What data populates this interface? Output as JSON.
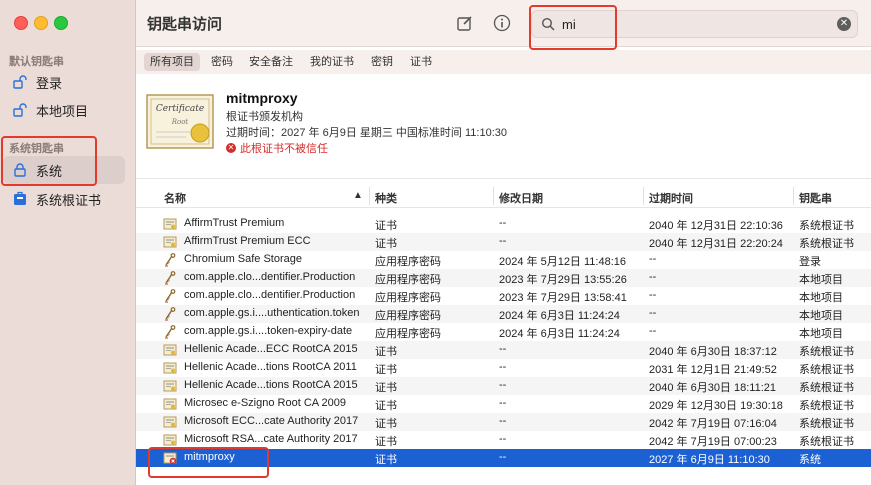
{
  "window": {
    "title": "钥匙串访问"
  },
  "sidebar": {
    "default_section": "默认钥匙串",
    "default_items": [
      {
        "label": "登录",
        "icon": "lock-open-icon"
      },
      {
        "label": "本地项目",
        "icon": "lock-open-icon"
      }
    ],
    "system_section": "系统钥匙串",
    "system_items": [
      {
        "label": "系统",
        "icon": "lock-icon",
        "selected": true
      },
      {
        "label": "系统根证书",
        "icon": "cabinet-icon"
      }
    ]
  },
  "search": {
    "value": "mi"
  },
  "tabs": [
    "所有项目",
    "密码",
    "安全备注",
    "我的证书",
    "密钥",
    "证书"
  ],
  "detail": {
    "name": "mitmproxy",
    "kind": "根证书颁发机构",
    "expire": "过期时间：2027 年 6月9日 星期三 中国标准时间 11:10:30",
    "trust": "此根证书不被信任"
  },
  "table": {
    "columns": [
      "名称",
      "种类",
      "修改日期",
      "过期时间",
      "钥匙串"
    ],
    "rows": [
      {
        "icon": "cert",
        "name": "AffirmTrust Premium",
        "kind": "证书",
        "modified": "--",
        "expires": "2040 年 12月31日 22:10:36",
        "keychain": "系统根证书"
      },
      {
        "icon": "cert",
        "name": "AffirmTrust Premium ECC",
        "kind": "证书",
        "modified": "--",
        "expires": "2040 年 12月31日 22:20:24",
        "keychain": "系统根证书"
      },
      {
        "icon": "key",
        "name": "Chromium Safe Storage",
        "kind": "应用程序密码",
        "modified": "2024 年 5月12日 11:48:16",
        "expires": "--",
        "keychain": "登录"
      },
      {
        "icon": "key",
        "name": "com.apple.clo...dentifier.Production",
        "kind": "应用程序密码",
        "modified": "2023 年 7月29日 13:55:26",
        "expires": "--",
        "keychain": "本地项目"
      },
      {
        "icon": "key",
        "name": "com.apple.clo...dentifier.Production",
        "kind": "应用程序密码",
        "modified": "2023 年 7月29日 13:58:41",
        "expires": "--",
        "keychain": "本地项目"
      },
      {
        "icon": "key",
        "name": "com.apple.gs.i....uthentication.token",
        "kind": "应用程序密码",
        "modified": "2024 年 6月3日 11:24:24",
        "expires": "--",
        "keychain": "本地项目"
      },
      {
        "icon": "key",
        "name": "com.apple.gs.i....token-expiry-date",
        "kind": "应用程序密码",
        "modified": "2024 年 6月3日 11:24:24",
        "expires": "--",
        "keychain": "本地项目"
      },
      {
        "icon": "cert",
        "name": "Hellenic Acade...ECC RootCA 2015",
        "kind": "证书",
        "modified": "--",
        "expires": "2040 年 6月30日 18:37:12",
        "keychain": "系统根证书"
      },
      {
        "icon": "cert",
        "name": "Hellenic Acade...tions RootCA 2011",
        "kind": "证书",
        "modified": "--",
        "expires": "2031 年 12月1日 21:49:52",
        "keychain": "系统根证书"
      },
      {
        "icon": "cert",
        "name": "Hellenic Acade...tions RootCA 2015",
        "kind": "证书",
        "modified": "--",
        "expires": "2040 年 6月30日 18:11:21",
        "keychain": "系统根证书"
      },
      {
        "icon": "cert",
        "name": "Microsec e-Szigno Root CA 2009",
        "kind": "证书",
        "modified": "--",
        "expires": "2029 年 12月30日 19:30:18",
        "keychain": "系统根证书"
      },
      {
        "icon": "cert",
        "name": "Microsoft ECC...cate Authority 2017",
        "kind": "证书",
        "modified": "--",
        "expires": "2042 年 7月19日 07:16:04",
        "keychain": "系统根证书"
      },
      {
        "icon": "cert",
        "name": "Microsoft RSA...cate Authority 2017",
        "kind": "证书",
        "modified": "--",
        "expires": "2042 年 7月19日 07:00:23",
        "keychain": "系统根证书"
      },
      {
        "icon": "cert-untrusted",
        "name": "mitmproxy",
        "kind": "证书",
        "modified": "--",
        "expires": "2027 年 6月9日 11:10:30",
        "keychain": "系统",
        "selected": true
      }
    ]
  },
  "colors": {
    "selection": "#1c61d4",
    "highlight_box": "#e23b2e",
    "untrusted": "#d62b2b"
  }
}
